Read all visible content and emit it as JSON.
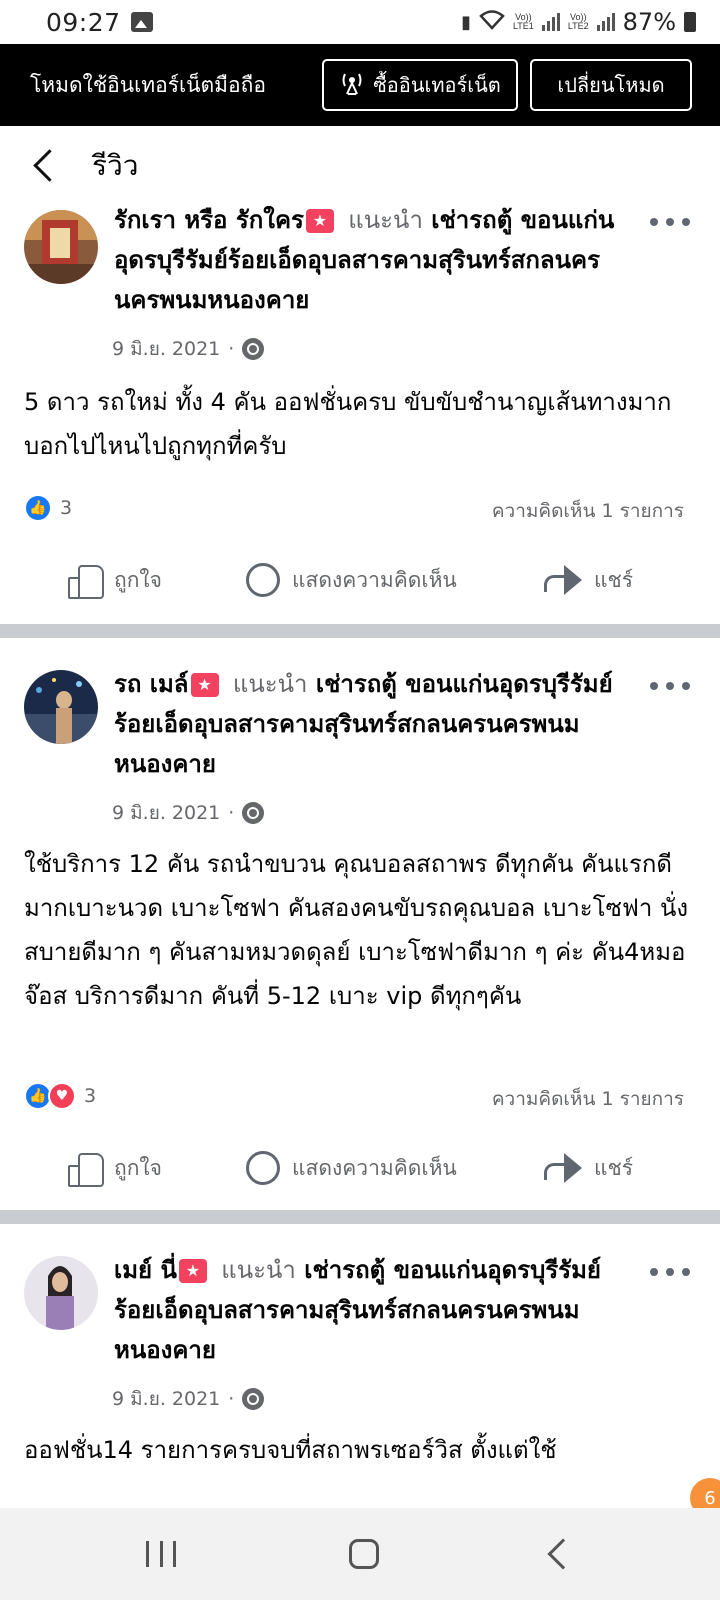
{
  "status_bar": {
    "time": "09:27",
    "lte1": "LTE1",
    "lte2": "LTE2",
    "vol1": "Vo))",
    "vol2": "Vo))",
    "battery": "87%"
  },
  "banner": {
    "text": "โหมดใช้อินเทอร์เน็ตมือถือ",
    "buy_label": "ซื้ออินเทอร์เน็ต",
    "switch_label": "เปลี่ยนโหมด"
  },
  "header": {
    "title": "รีวิว"
  },
  "posts": [
    {
      "author": "รักเรา หรือ รักใคร",
      "recommends": "แนะนำ",
      "page": "เช่ารถตู้ ขอนแก่นอุดรบุรีรัมย์ร้อยเอ็ดอุบลสารคามสุรินทร์สกลนครนครพนมหนองคาย",
      "date": "9 มิ.ย. 2021",
      "body": "5 ดาว รถใหม่ ทั้ง 4 คัน ออฟชั่นครบ ขับขับชำนาญเส้นทางมากบอกไปไหนไปถูกทุกที่ครับ",
      "reaction_count": "3",
      "comments": "ความคิดเห็น 1 รายการ"
    },
    {
      "author": "รถ เมล์",
      "recommends": "แนะนำ",
      "page": "เช่ารถตู้ ขอนแก่นอุดรบุรีรัมย์ร้อยเอ็ดอุบลสารคามสุรินทร์สกลนครนครพนมหนองคาย",
      "date": "9 มิ.ย. 2021",
      "body": "ใช้บริการ 12 คัน รถนำขบวน คุณบอลสถาพร ดีทุกคัน คันแรกดีมากเบาะนวด เบาะโซฟา คันสองคนขับรถคุณบอล เบาะโซฟา นั่งสบายดีมาก ๆ คันสามหมวดดุลย์ เบาะโซฟาดีมาก ๆ ค่ะ คัน4หมอจ๊อส บริการดีมาก คันที่ 5-12 เบาะ vip ดีทุกๆคัน",
      "reaction_count": "3",
      "comments": "ความคิดเห็น 1 รายการ"
    },
    {
      "author": "เมย์ นี่",
      "recommends": "แนะนำ",
      "page": "เช่ารถตู้ ขอนแก่นอุดรบุรีรัมย์ร้อยเอ็ดอุบลสารคามสุรินทร์สกลนครนครพนมหนองคาย",
      "date": "9 มิ.ย. 2021",
      "body": "ออฟชั่น14 รายการครบจบที่สถาพรเซอร์วิส ตั้งแต่ใช้"
    }
  ],
  "actions": {
    "like": "ถูกใจ",
    "comment": "แสดงความคิดเห็น",
    "share": "แชร์"
  },
  "colors": {
    "brand_blue": "#1877f2",
    "love_red": "#f33e58",
    "recommend_badge": "#f3425f",
    "muted_text": "#65676b",
    "divider": "#c9ccd1"
  }
}
